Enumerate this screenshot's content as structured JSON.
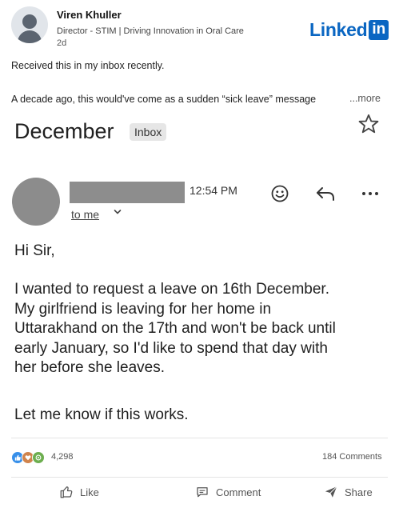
{
  "post": {
    "author_name": "Viren Khuller",
    "author_headline": "Director - STIM | Driving Innovation in Oral Care",
    "age": "2d",
    "brand": {
      "wordmark": "Linked",
      "box": "in"
    },
    "line1": "Received this in my inbox recently.",
    "line2": "A decade ago, this would've come as a sudden “sick leave” message",
    "more_label": "...more"
  },
  "email": {
    "subject": "December",
    "label_chip": "Inbox",
    "time": "12:54 PM",
    "to_label": "to me",
    "greeting": "Hi Sir,",
    "body_lines": [
      "I wanted to request a leave on 16th December.",
      "My girlfriend is leaving for her home in",
      "Uttarakhand on the 17th and won't be back until",
      "early January, so I'd like to spend that day with",
      "her before she leaves."
    ],
    "closing": "Let me know if this works."
  },
  "social": {
    "reaction_count": "4,298",
    "comments_count": "184 Comments",
    "actions": {
      "like": "Like",
      "comment": "Comment",
      "share": "Share"
    }
  },
  "colors": {
    "brand": "#0a66c2",
    "redaction": "#8d8d8d"
  }
}
